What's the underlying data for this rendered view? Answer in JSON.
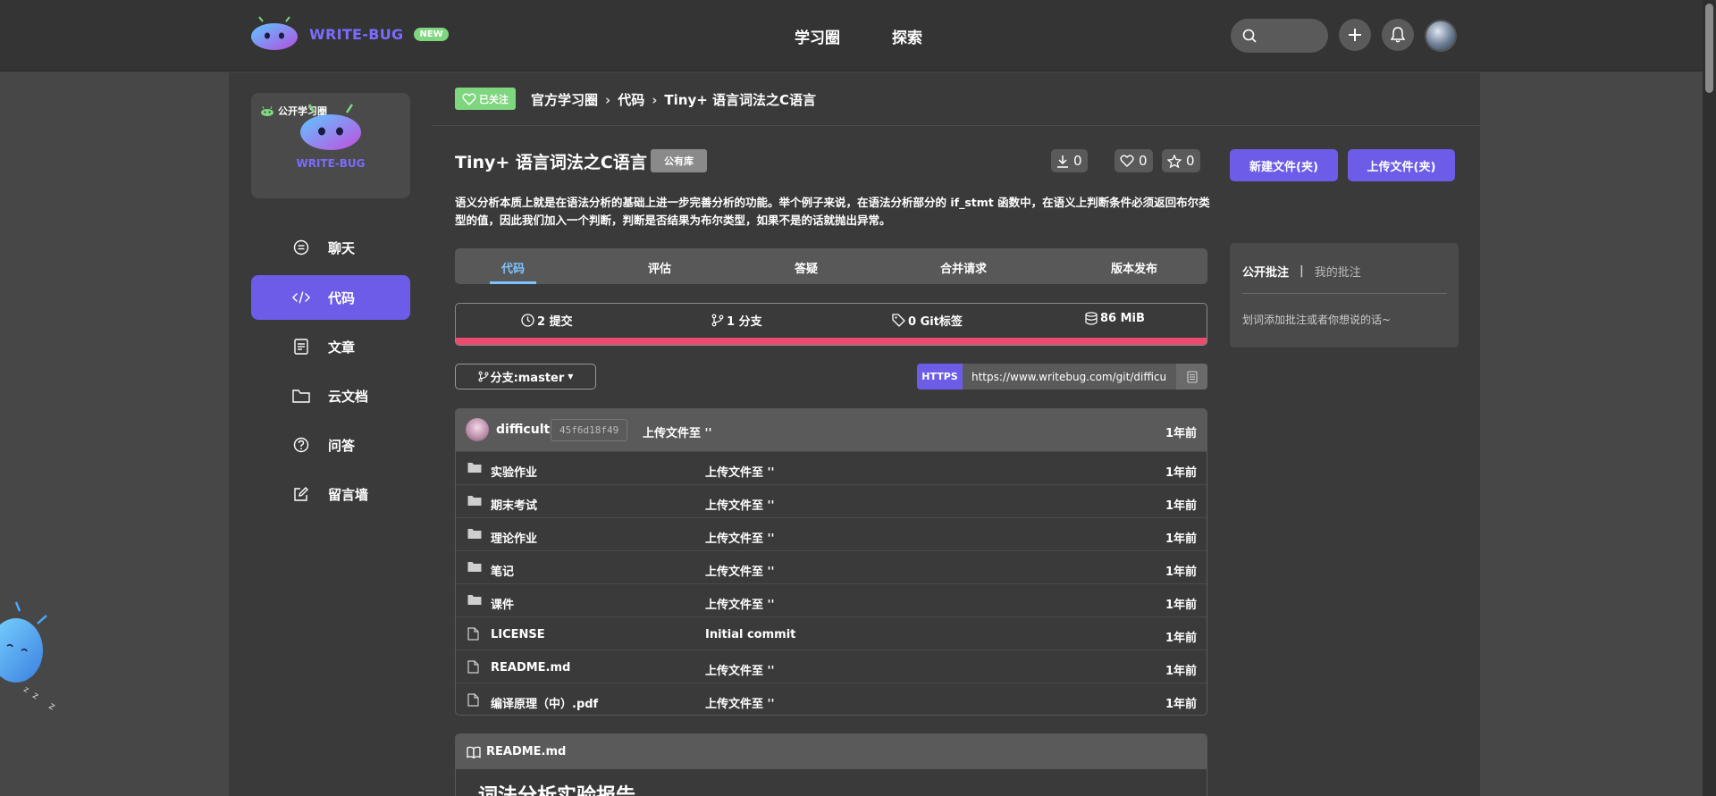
{
  "header": {
    "brand": "WRITE-BUG",
    "new_badge": "NEW",
    "nav": [
      "学习圈",
      "探索"
    ]
  },
  "sidebar": {
    "group_tag": "公开学习圈",
    "group_logo_text": "WRITE-BUG",
    "items": [
      {
        "label": "聊天",
        "icon": "chat-icon",
        "active": false
      },
      {
        "label": "代码",
        "icon": "code-icon",
        "active": true
      },
      {
        "label": "文章",
        "icon": "article-icon",
        "active": false
      },
      {
        "label": "云文档",
        "icon": "folder-icon",
        "active": false
      },
      {
        "label": "问答",
        "icon": "question-icon",
        "active": false
      },
      {
        "label": "留言墙",
        "icon": "edit-icon",
        "active": false
      }
    ]
  },
  "breadcrumb": {
    "follow_label": "已关注",
    "items": [
      "官方学习圈",
      "代码",
      "Tiny+ 语言词法之C语言"
    ]
  },
  "repo": {
    "title": "Tiny+ 语言词法之C语言",
    "visibility": "公有库",
    "downloads": "0",
    "likes": "0",
    "stars": "0",
    "description": "语义分析本质上就是在语法分析的基础上进一步完善分析的功能。举个例子来说，在语法分析部分的 if_stmt 函数中，在语义上判断条件必须返回布尔类型的值，因此我们加入一个判断，判断是否结果为布尔类型，如果不是的话就抛出异常。"
  },
  "tabs": [
    "代码",
    "评估",
    "答疑",
    "合并请求",
    "版本发布"
  ],
  "stats": {
    "commits": "2 提交",
    "branches": "1 分支",
    "tags": "0 Git标签",
    "size": "86 MiB"
  },
  "branch_selector": "分支:master",
  "clone": {
    "protocol": "HTTPS",
    "url": "https://www.writebug.com/git/difficu"
  },
  "last_commit": {
    "author": "difficult",
    "hash": "45f6d18f49",
    "message": "上传文件至 ''",
    "time": "1年前"
  },
  "files": [
    {
      "name": "实验作业",
      "type": "folder",
      "message": "上传文件至 ''",
      "time": "1年前"
    },
    {
      "name": "期末考试",
      "type": "folder",
      "message": "上传文件至 ''",
      "time": "1年前"
    },
    {
      "name": "理论作业",
      "type": "folder",
      "message": "上传文件至 ''",
      "time": "1年前"
    },
    {
      "name": "笔记",
      "type": "folder",
      "message": "上传文件至 ''",
      "time": "1年前"
    },
    {
      "name": "课件",
      "type": "folder",
      "message": "上传文件至 ''",
      "time": "1年前"
    },
    {
      "name": "LICENSE",
      "type": "file",
      "message": "Initial commit",
      "time": "1年前"
    },
    {
      "name": "README.md",
      "type": "file",
      "message": "上传文件至 ''",
      "time": "1年前"
    },
    {
      "name": "编译原理（中）.pdf",
      "type": "file",
      "message": "上传文件至 ''",
      "time": "1年前"
    }
  ],
  "readme": {
    "filename": "README.md",
    "heading": "词法分析实验报告"
  },
  "actions": {
    "new_folder": "新建文件(夹)",
    "upload": "上传文件(夹)"
  },
  "annotations": {
    "tab_public": "公开批注",
    "tab_mine": "我的批注",
    "separator": "|",
    "hint": "划词添加批注或者你想说的话~"
  },
  "colors": {
    "accent": "#6c5ce7",
    "green": "#7ed67e",
    "pink_bar": "#e94c6f",
    "tab_active": "#7ec3ff"
  }
}
